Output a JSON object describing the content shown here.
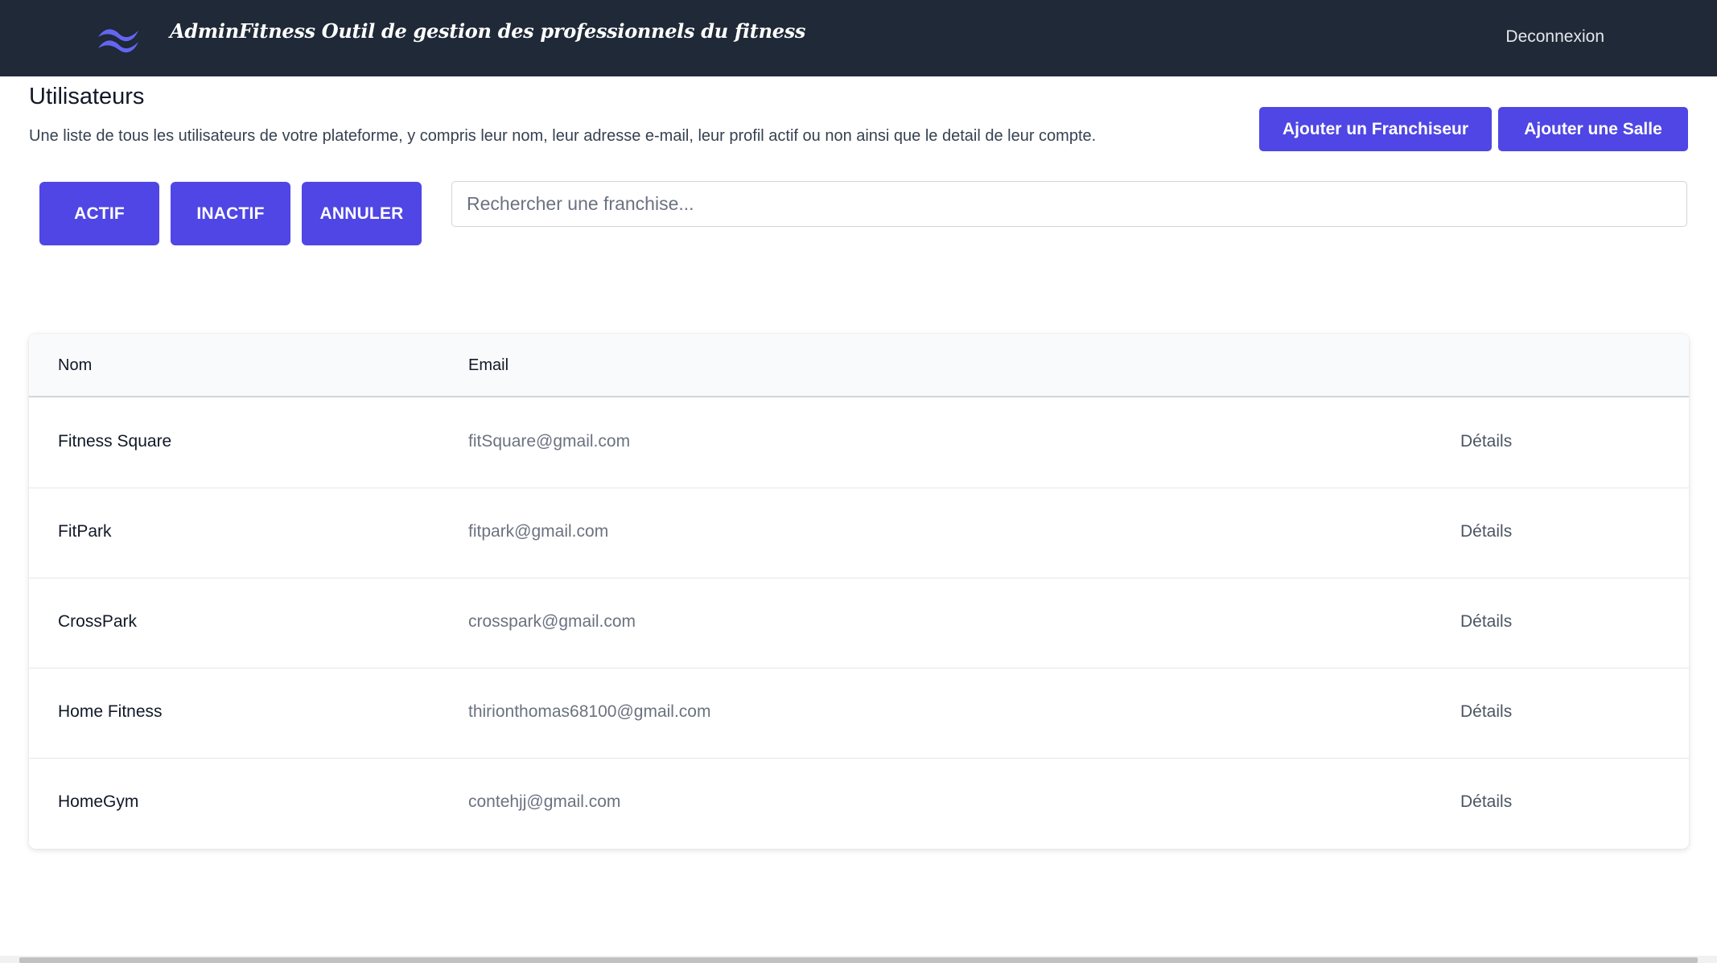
{
  "header": {
    "brand": "AdminFitness Outil de gestion des professionnels du fitness",
    "logout": "Deconnexion",
    "logo_icon": "wave-logo-icon",
    "accent": "#4f46e5",
    "background": "#1f2937"
  },
  "page": {
    "title": "Utilisateurs",
    "description": "Une liste de tous les utilisateurs de votre plateforme, y compris leur nom, leur adresse e-mail, leur profil actif ou non ainsi que le detail de leur compte.",
    "add_franchise_label": "Ajouter un Franchiseur",
    "add_room_label": "Ajouter une Salle"
  },
  "filters": {
    "active": "ACTIF",
    "inactive": "INACTIF",
    "cancel": "ANNULER"
  },
  "search": {
    "placeholder": "Rechercher une franchise...",
    "value": ""
  },
  "table": {
    "columns": [
      "Nom",
      "Email"
    ],
    "rows": [
      {
        "name": "Fitness Square",
        "email": "fitSquare@gmail.com",
        "action": "Détails"
      },
      {
        "name": "FitPark",
        "email": "fitpark@gmail.com",
        "action": "Détails"
      },
      {
        "name": "CrossPark",
        "email": "crosspark@gmail.com",
        "action": "Détails"
      },
      {
        "name": "Home Fitness",
        "email": "thirionthomas68100@gmail.com",
        "action": "Détails"
      },
      {
        "name": "HomeGym",
        "email": "contehjj@gmail.com",
        "action": "Détails"
      }
    ]
  }
}
